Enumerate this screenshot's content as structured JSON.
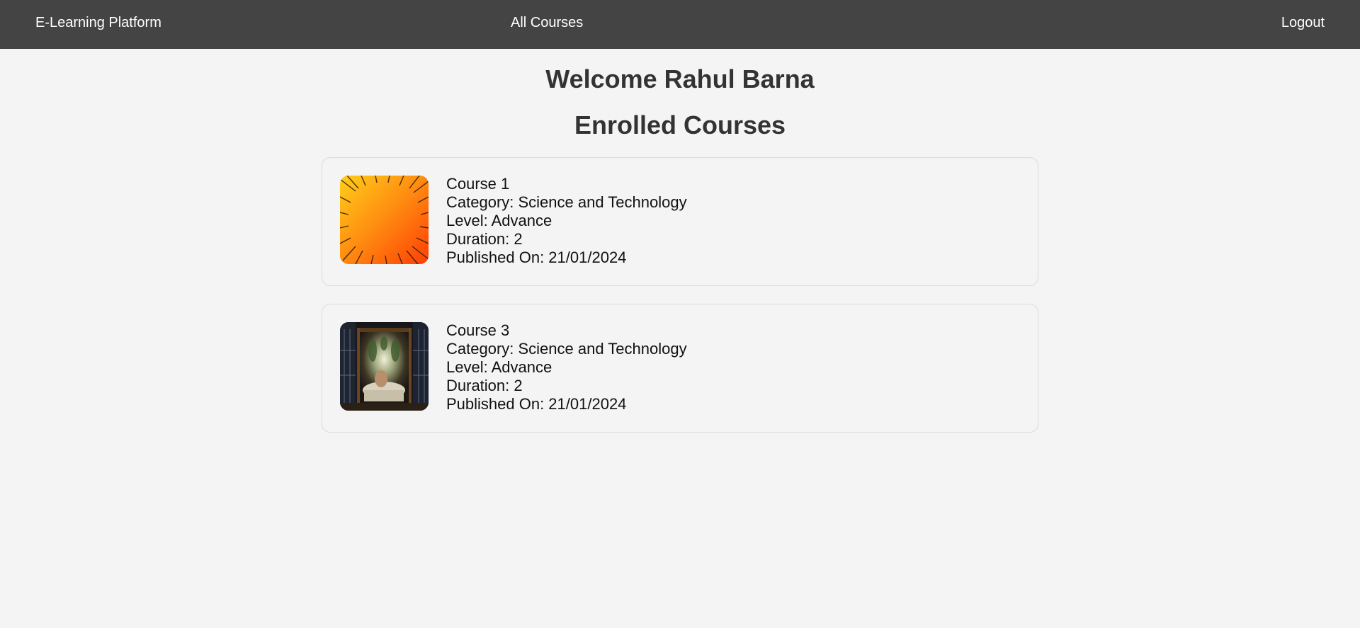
{
  "nav": {
    "brand": "E-Learning Platform",
    "all_courses": "All Courses",
    "logout": "Logout"
  },
  "main": {
    "welcome": "Welcome Rahul Barna",
    "section_title": "Enrolled Courses"
  },
  "courses": [
    {
      "name": "Course 1",
      "category": "Category: Science and Technology",
      "level": "Level: Advance",
      "duration": "Duration: 2",
      "published": "Published On: 21/01/2024",
      "thumbnail": "orange-starburst-image"
    },
    {
      "name": "Course 3",
      "category": "Category: Science and Technology",
      "level": "Level: Advance",
      "duration": "Duration: 2",
      "published": "Published On: 21/01/2024",
      "thumbnail": "dining-room-photo-image"
    }
  ],
  "colors": {
    "navbar_bg": "#444444",
    "page_bg": "#f4f4f4",
    "card_border": "#dcdcdc",
    "heading_text": "#333333"
  }
}
